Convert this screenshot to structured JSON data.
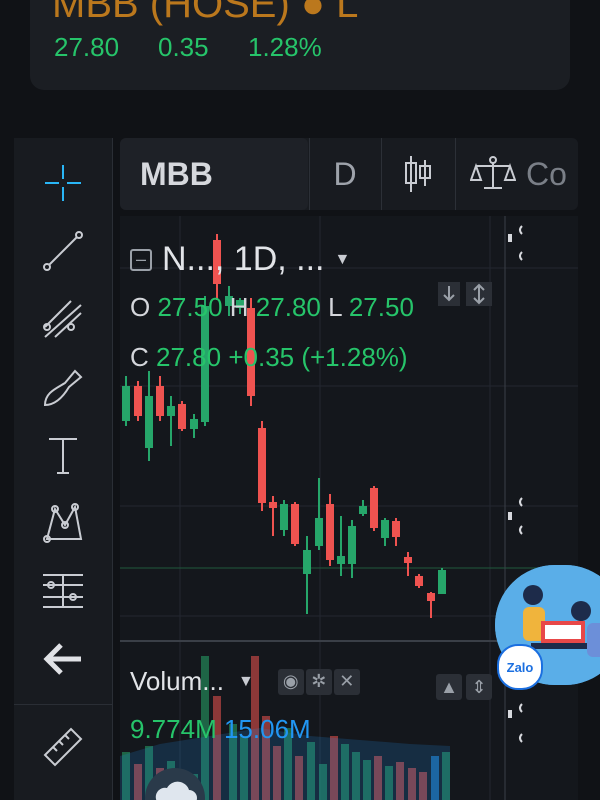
{
  "quote": {
    "title": "MBB (HOSE)  ●  L",
    "price": "27.80",
    "change": "0.35",
    "change_pct": "1.28%"
  },
  "toolbar": {
    "items": [
      "crosshair-icon",
      "trend-line-icon",
      "fib-tool-icon",
      "brush-icon",
      "text-tool-icon",
      "pattern-icon",
      "measure-lines-icon",
      "back-arrow-icon",
      "ruler-icon"
    ]
  },
  "header": {
    "symbol": "MBB",
    "interval": "D",
    "chart_type_icon": "candlestick-icon",
    "compare_label": "Co"
  },
  "legend": {
    "title": "N..., 1D, ...",
    "o_label": "O",
    "o_value": "27.50",
    "h_label": "H",
    "h_value": "27.80",
    "l_label": "L",
    "l_value": "27.50",
    "c_label": "C",
    "c_value": "27.80",
    "change_text": "+0.35 (+1.28%)"
  },
  "volume": {
    "label": "Volum...",
    "value_1": "9.774M",
    "value_2": "15.06M"
  },
  "ad": {
    "badge": "Zalo"
  },
  "colors": {
    "up": "#26a66a",
    "down": "#ef5350",
    "accent": "#2196f3"
  }
}
